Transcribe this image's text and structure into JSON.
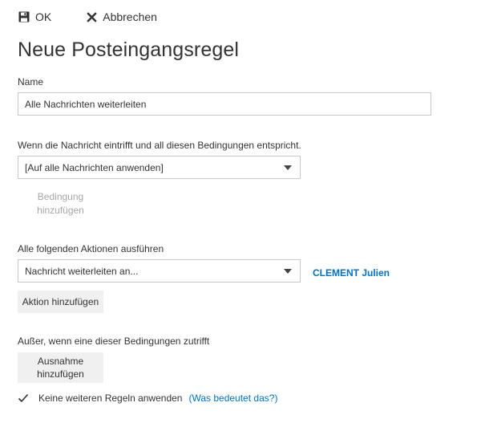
{
  "toolbar": {
    "ok_label": "OK",
    "cancel_label": "Abbrechen"
  },
  "title": "Neue Posteingangsregel",
  "name_section": {
    "label": "Name",
    "value": "Alle Nachrichten weiterleiten"
  },
  "conditions": {
    "label": "Wenn die Nachricht eintrifft und all diesen Bedingungen entspricht.",
    "selected": "[Auf alle Nachrichten anwenden]",
    "add_label_line1": "Bedingung",
    "add_label_line2": "hinzufügen"
  },
  "actions": {
    "label": "Alle folgenden Aktionen ausführen",
    "selected": "Nachricht weiterleiten an...",
    "recipient": "CLEMENT Julien",
    "add_label": "Aktion hinzufügen"
  },
  "exceptions": {
    "label": "Außer, wenn eine dieser Bedingungen zutrifft",
    "add_label_line1": "Ausnahme",
    "add_label_line2": "hinzufügen"
  },
  "stop_processing": {
    "checked": true,
    "label": "Keine weiteren Regeln anwenden",
    "open_paren": "(",
    "help_link": "Was bedeutet das?",
    "close_paren": ")"
  },
  "colors": {
    "link": "#0072c6",
    "button_bg": "#f0f0f0",
    "border": "#c8c8c8",
    "disabled_text": "#a6a6a6"
  },
  "icons": {
    "ok": "save-icon",
    "cancel": "close-icon",
    "dropdown": "chevron-down-icon",
    "checkbox": "checkmark-icon"
  }
}
